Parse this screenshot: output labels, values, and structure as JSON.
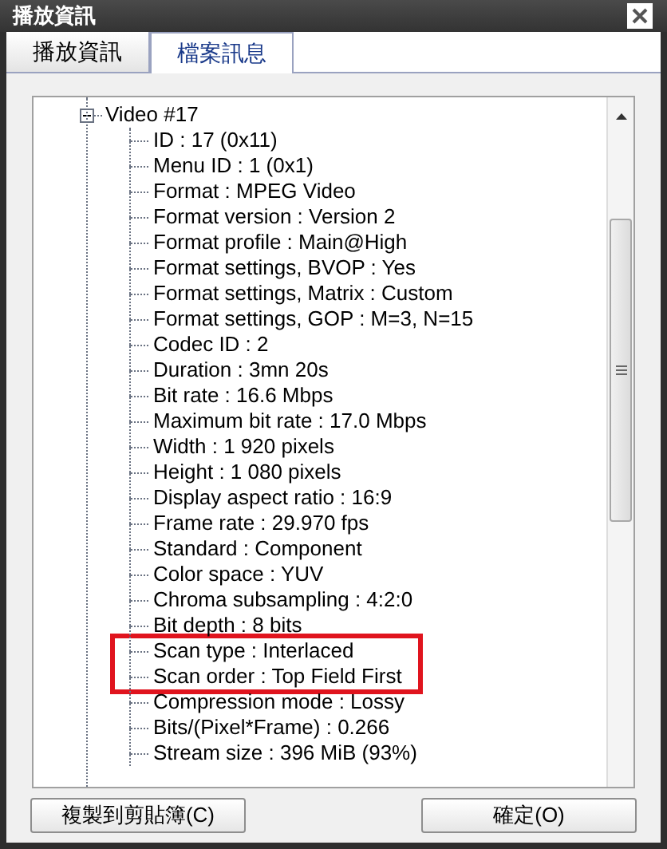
{
  "window": {
    "title": "播放資訊"
  },
  "tabs": [
    {
      "label": "播放資訊",
      "selected": false
    },
    {
      "label": "檔案訊息",
      "selected": true
    }
  ],
  "tree": {
    "nodes": [
      {
        "label": "Video #17",
        "expanded": true,
        "children": [
          {
            "label": "ID : 17 (0x11)",
            "highlighted": false
          },
          {
            "label": "Menu ID : 1 (0x1)",
            "highlighted": false
          },
          {
            "label": "Format : MPEG Video",
            "highlighted": false
          },
          {
            "label": "Format version : Version 2",
            "highlighted": false
          },
          {
            "label": "Format profile : Main@High",
            "highlighted": false
          },
          {
            "label": "Format settings, BVOP : Yes",
            "highlighted": false
          },
          {
            "label": "Format settings, Matrix : Custom",
            "highlighted": false
          },
          {
            "label": "Format settings, GOP : M=3, N=15",
            "highlighted": false
          },
          {
            "label": "Codec ID : 2",
            "highlighted": false
          },
          {
            "label": "Duration : 3mn 20s",
            "highlighted": false
          },
          {
            "label": "Bit rate : 16.6 Mbps",
            "highlighted": false
          },
          {
            "label": "Maximum bit rate : 17.0 Mbps",
            "highlighted": false
          },
          {
            "label": "Width : 1 920 pixels",
            "highlighted": false
          },
          {
            "label": "Height : 1 080 pixels",
            "highlighted": false
          },
          {
            "label": "Display aspect ratio : 16:9",
            "highlighted": false
          },
          {
            "label": "Frame rate : 29.970 fps",
            "highlighted": false
          },
          {
            "label": "Standard : Component",
            "highlighted": false
          },
          {
            "label": "Color space : YUV",
            "highlighted": false
          },
          {
            "label": "Chroma subsampling : 4:2:0",
            "highlighted": false
          },
          {
            "label": "Bit depth : 8 bits",
            "highlighted": false
          },
          {
            "label": "Scan type : Interlaced",
            "highlighted": true
          },
          {
            "label": "Scan order : Top Field First",
            "highlighted": true
          },
          {
            "label": "Compression mode : Lossy",
            "highlighted": false
          },
          {
            "label": "Bits/(Pixel*Frame) : 0.266",
            "highlighted": false
          },
          {
            "label": "Stream size : 396 MiB (93%)",
            "highlighted": false
          }
        ]
      }
    ]
  },
  "buttons": [
    {
      "label": "複製到剪貼簿(C)"
    },
    {
      "label": "確定(O)"
    }
  ]
}
